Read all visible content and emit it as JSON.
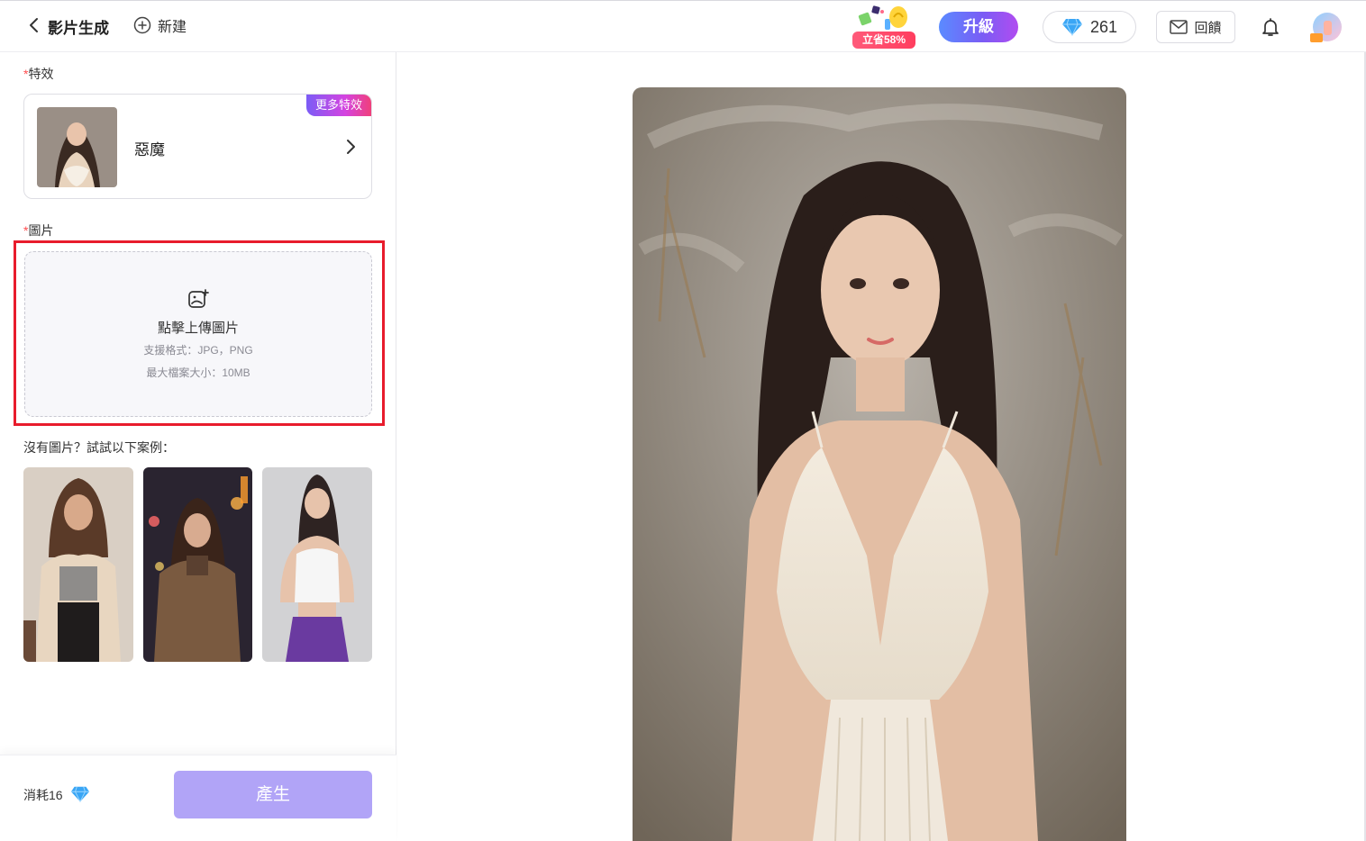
{
  "header": {
    "title": "影片生成",
    "new_label": "新建",
    "promo_label": "立省58%",
    "upgrade_label": "升級",
    "gem_count": "261",
    "feedback_label": "回饋"
  },
  "effect": {
    "section_label": "特效",
    "required_mark": "*",
    "name": "惡魔",
    "more_badge": "更多特效"
  },
  "image": {
    "section_label": "圖片",
    "required_mark": "*",
    "upload_title": "點擊上傳圖片",
    "formats": "支援格式：JPG，PNG",
    "max_size": "最大檔案大小：10MB"
  },
  "samples": {
    "title": "沒有圖片？試試以下案例："
  },
  "bottom": {
    "cost_label": "消耗16",
    "generate_label": "產生"
  },
  "colors": {
    "accent": "#7a5cf5",
    "generate_disabled": "#b1a4f7",
    "highlight": "#e81c2c",
    "required": "#ff4d4f",
    "gem": "#3aa6f5"
  }
}
